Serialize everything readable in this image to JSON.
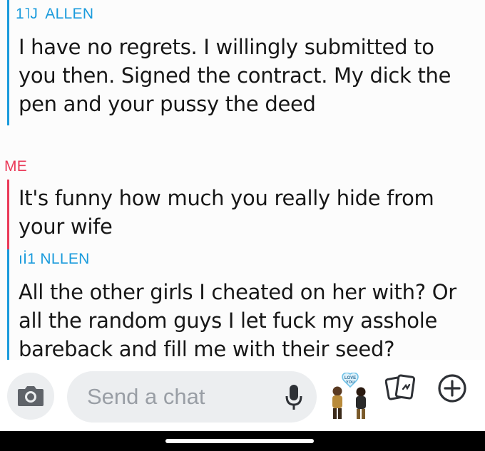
{
  "conversation": {
    "messages": [
      {
        "sender": "ALLEN",
        "sender_prefix": "1˥J",
        "text_lines": [
          "I have no regrets. I willingly submitted to",
          "you then. Signed the contract. My dick the",
          "pen and your pussy the deed"
        ]
      },
      {
        "sender": "ME",
        "text_lines": [
          "It's funny how much you really hide from",
          "your wife"
        ]
      },
      {
        "sender": "NLLEN",
        "sender_prefix": "ıİ1",
        "text_lines": [
          "All the other girls I cheated on her with? Or",
          "all the random guys I let fuck my asshole",
          "bareback and fill me with their seed?"
        ]
      }
    ]
  },
  "composer": {
    "placeholder": "Send a chat",
    "camera_icon": "camera-icon",
    "mic_icon": "microphone-icon",
    "bitmoji_icon": "bitmoji-icon",
    "bitmoji_caption": "LOVE YOU",
    "cards_icon": "cards-icon",
    "plus_icon": "plus-circle-icon"
  },
  "colors": {
    "friend": "#1a9bdc",
    "me": "#ea3a59",
    "text": "#171717",
    "placeholder": "#999ea5"
  }
}
